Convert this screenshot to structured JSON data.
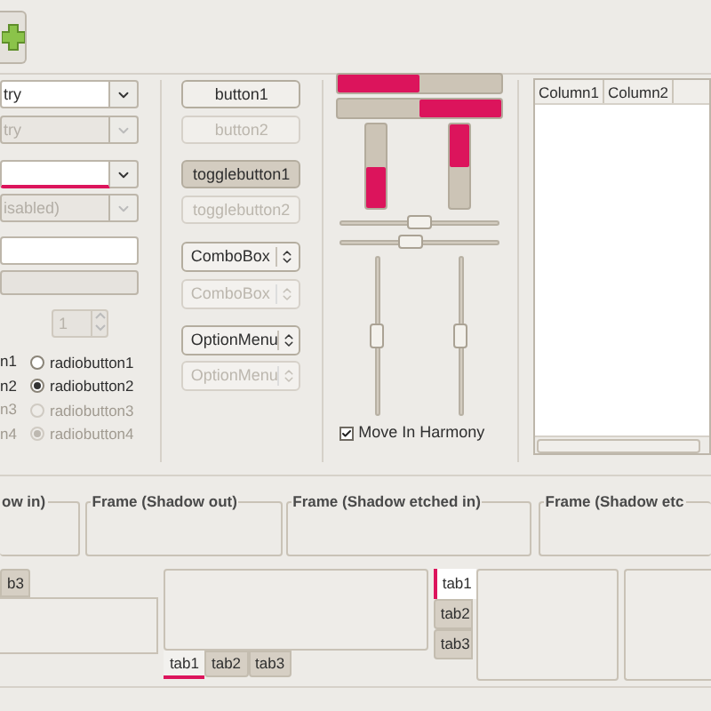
{
  "entries": [
    {
      "kind": "combo_entry",
      "value": "try",
      "disabled": false,
      "focused": false
    },
    {
      "kind": "combo_entry",
      "value": "try",
      "disabled": true,
      "focused": false
    },
    {
      "kind": "combo_entry",
      "disabled": false,
      "focused": true
    },
    {
      "kind": "combo_entry",
      "value": "isabled)",
      "disabled": true,
      "focused": false
    },
    {
      "kind": "entry",
      "disabled": false,
      "focused": false
    },
    {
      "kind": "entry",
      "disabled": true,
      "focused": false
    }
  ],
  "spin": {
    "value": "1",
    "disabled": true
  },
  "radios_left": [
    {
      "label": "n1",
      "disabled": false
    },
    {
      "label": "n2",
      "disabled": false
    },
    {
      "label": "n3",
      "disabled": true
    },
    {
      "label": "n4",
      "disabled": true
    }
  ],
  "radios": [
    {
      "label": "radiobutton1",
      "selected": false,
      "disabled": false
    },
    {
      "label": "radiobutton2",
      "selected": true,
      "disabled": false
    },
    {
      "label": "radiobutton3",
      "selected": false,
      "disabled": true
    },
    {
      "label": "radiobutton4",
      "selected": true,
      "disabled": true
    }
  ],
  "buttons": [
    {
      "kind": "button",
      "label": "button1",
      "disabled": false
    },
    {
      "kind": "button",
      "label": "button2",
      "disabled": true
    },
    {
      "kind": "toggle",
      "label": "togglebutton1",
      "pressed": true,
      "disabled": false
    },
    {
      "kind": "toggle",
      "label": "togglebutton2",
      "pressed": false,
      "disabled": true
    },
    {
      "kind": "combo",
      "label": "ComboBox",
      "disabled": false
    },
    {
      "kind": "combo",
      "label": "ComboBox",
      "disabled": true
    },
    {
      "kind": "option_menu",
      "label": "OptionMenu",
      "disabled": false
    },
    {
      "kind": "option_menu",
      "label": "OptionMenu",
      "disabled": true
    }
  ],
  "progress_horizontal": [
    {
      "level": 0.5,
      "inverted": false
    },
    {
      "level": 0.5,
      "inverted": true
    }
  ],
  "progress_vertical": [
    {
      "level": 0.5,
      "inverted": false
    },
    {
      "level": 0.5,
      "inverted": true
    }
  ],
  "scales_horizontal": [
    {
      "level": 0.5
    },
    {
      "level": 0.45
    }
  ],
  "scales_vertical": [
    {
      "level": 0.5
    },
    {
      "level": 0.5
    }
  ],
  "harmony": {
    "label": "Move In Harmony",
    "checked": true
  },
  "tree": {
    "columns": [
      "Column1",
      "Column2"
    ]
  },
  "frames": [
    {
      "label": "ow in)"
    },
    {
      "label": "Frame (Shadow out)"
    },
    {
      "label": "Frame (Shadow etched in)"
    },
    {
      "label": "Frame (Shadow etc"
    }
  ],
  "notebooks": [
    {
      "kind": "top",
      "tabs": [
        {
          "label": "b3",
          "selected": false
        }
      ]
    },
    {
      "kind": "bottom",
      "tabs": [
        {
          "label": "tab1",
          "selected": true
        },
        {
          "label": "tab2",
          "selected": false
        },
        {
          "label": "tab3",
          "selected": false
        }
      ]
    },
    {
      "kind": "left",
      "tabs": [
        {
          "label": "tab1",
          "selected": true
        },
        {
          "label": "tab2",
          "selected": false
        },
        {
          "label": "tab3",
          "selected": false
        }
      ]
    }
  ]
}
